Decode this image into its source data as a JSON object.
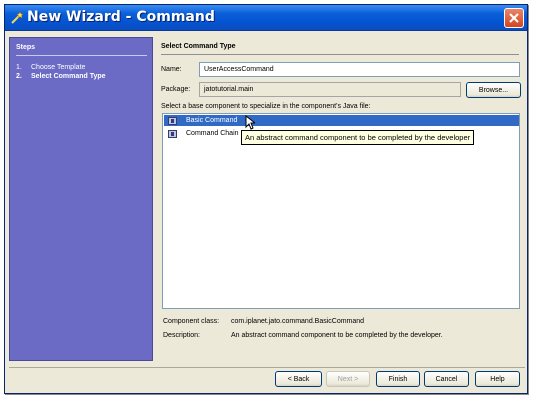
{
  "window": {
    "title": "New Wizard - Command"
  },
  "steps": {
    "title": "Steps",
    "items": [
      {
        "num": "1.",
        "label": "Choose Template",
        "current": false
      },
      {
        "num": "2.",
        "label": "Select Command Type",
        "current": true
      }
    ]
  },
  "section": {
    "title": "Select Command Type"
  },
  "form": {
    "name_label": "Name:",
    "name_value": "UserAccessCommand",
    "package_label": "Package:",
    "package_value": "jatotutorial.main",
    "browse_label": "Browse..."
  },
  "components": {
    "prompt": "Select a base component to specialize in the component's Java file:",
    "items": [
      {
        "label": "Basic Command",
        "selected": true
      },
      {
        "label": "Command Chain",
        "selected": false
      }
    ],
    "tooltip": "An abstract command component to be completed by the developer"
  },
  "details": {
    "class_label": "Component class:",
    "class_value": "com.iplanet.jato.command.BasicCommand",
    "description_label": "Description:",
    "description_value": "An abstract command component to be completed by the developer."
  },
  "buttons": {
    "back": "< Back",
    "next": "Next >",
    "finish": "Finish",
    "cancel": "Cancel",
    "help": "Help"
  }
}
